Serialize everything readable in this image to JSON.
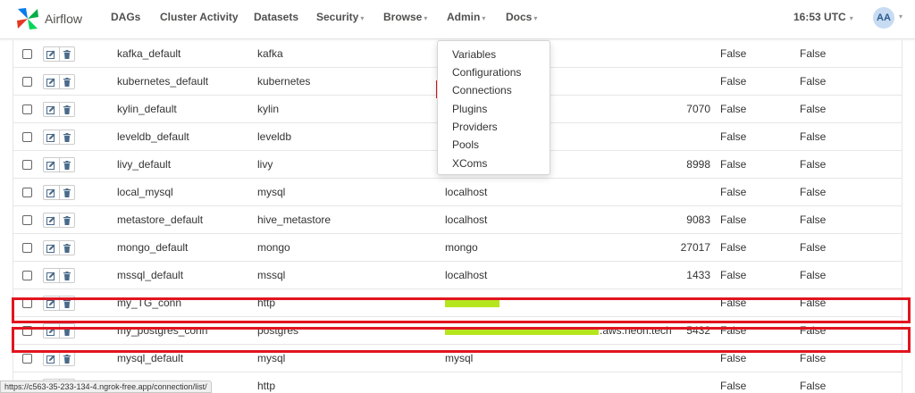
{
  "brand": {
    "name": "Airflow"
  },
  "nav": {
    "dags": "DAGs",
    "cluster_activity": "Cluster Activity",
    "datasets": "Datasets",
    "security": "Security",
    "browse": "Browse",
    "admin": "Admin",
    "docs": "Docs",
    "time": "16:53 UTC",
    "user_initials": "AA"
  },
  "admin_menu": {
    "items": [
      "Variables",
      "Configurations",
      "Connections",
      "Plugins",
      "Providers",
      "Pools",
      "XComs"
    ],
    "highlighted": "Connections"
  },
  "connections": [
    {
      "conn_id": "kafka_default",
      "conn_type": "kafka",
      "host": "",
      "port": "",
      "encrypted": "False",
      "extra_encrypted": "False"
    },
    {
      "conn_id": "kubernetes_default",
      "conn_type": "kubernetes",
      "host": "",
      "port": "",
      "encrypted": "False",
      "extra_encrypted": "False"
    },
    {
      "conn_id": "kylin_default",
      "conn_type": "kylin",
      "host": "",
      "port": "7070",
      "encrypted": "False",
      "extra_encrypted": "False"
    },
    {
      "conn_id": "leveldb_default",
      "conn_type": "leveldb",
      "host": "",
      "port": "",
      "encrypted": "False",
      "extra_encrypted": "False"
    },
    {
      "conn_id": "livy_default",
      "conn_type": "livy",
      "host": "",
      "port": "8998",
      "encrypted": "False",
      "extra_encrypted": "False"
    },
    {
      "conn_id": "local_mysql",
      "conn_type": "mysql",
      "host": "localhost",
      "port": "",
      "encrypted": "False",
      "extra_encrypted": "False"
    },
    {
      "conn_id": "metastore_default",
      "conn_type": "hive_metastore",
      "host": "localhost",
      "port": "9083",
      "encrypted": "False",
      "extra_encrypted": "False"
    },
    {
      "conn_id": "mongo_default",
      "conn_type": "mongo",
      "host": "mongo",
      "port": "27017",
      "encrypted": "False",
      "extra_encrypted": "False"
    },
    {
      "conn_id": "mssql_default",
      "conn_type": "mssql",
      "host": "localhost",
      "port": "1433",
      "encrypted": "False",
      "extra_encrypted": "False"
    },
    {
      "conn_id": "my_TG_conn",
      "conn_type": "http",
      "host": "",
      "port": "",
      "encrypted": "False",
      "extra_encrypted": "False"
    },
    {
      "conn_id": "my_postgres_conn",
      "conn_type": "postgres",
      "host": ".aws.neon.tech",
      "port": "5432",
      "encrypted": "False",
      "extra_encrypted": "False"
    },
    {
      "conn_id": "mysql_default",
      "conn_type": "mysql",
      "host": "mysql",
      "port": "",
      "encrypted": "False",
      "extra_encrypted": "False"
    },
    {
      "conn_id": "",
      "conn_type": "http",
      "host": "",
      "port": "",
      "encrypted": "False",
      "extra_encrypted": "False"
    }
  ],
  "status_url": "https://c563-35-233-134-4.ngrok-free.app/connection/list/",
  "colors": {
    "highlight": "#e1151f",
    "redaction": "#b5e51d",
    "text": "#51504f"
  },
  "icons": [
    "airflow-logo-icon",
    "edit-icon",
    "trash-icon",
    "chevron-down-icon"
  ]
}
